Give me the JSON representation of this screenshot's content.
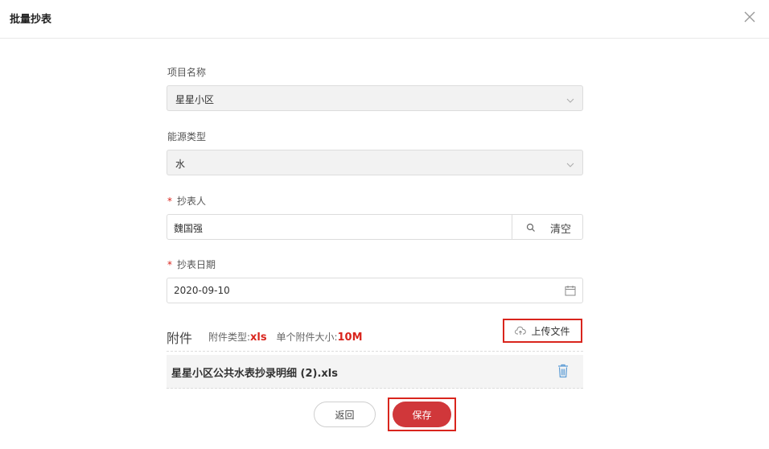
{
  "dialog": {
    "title": "批量抄表",
    "close_icon": "close-icon"
  },
  "form": {
    "project": {
      "label": "项目名称",
      "value": "星星小区"
    },
    "energy_type": {
      "label": "能源类型",
      "value": "水"
    },
    "reader": {
      "required_mark": "*",
      "label": "抄表人",
      "value": "魏国强",
      "clear_label": "清空"
    },
    "date": {
      "required_mark": "*",
      "label": "抄表日期",
      "value": "2020-09-10"
    }
  },
  "attachments": {
    "title": "附件",
    "type_label": "附件类型:",
    "type_value": "xls",
    "size_label": "单个附件大小:",
    "size_value": "10M",
    "upload_label": "上传文件",
    "files": [
      {
        "name": "星星小区公共水表抄录明细 (2).xls"
      }
    ]
  },
  "footer": {
    "back_label": "返回",
    "save_label": "保存"
  },
  "colors": {
    "accent": "#d9251d",
    "save_button": "#d0373a"
  }
}
